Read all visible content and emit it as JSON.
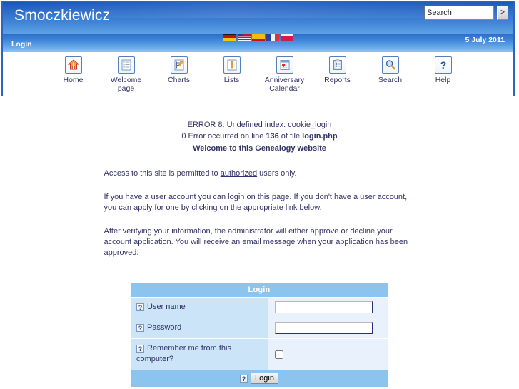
{
  "header": {
    "site_title": "Smoczkiewicz",
    "login_status": "Login",
    "date": "5 July 2011",
    "search": {
      "value": "Search",
      "placeholder": "Search",
      "go_label": ">"
    },
    "languages": [
      {
        "name": "german-flag",
        "code": "de"
      },
      {
        "name": "us-flag",
        "code": "us"
      },
      {
        "name": "spanish-flag",
        "code": "es"
      },
      {
        "name": "french-flag",
        "code": "fr"
      },
      {
        "name": "polish-flag",
        "code": "pl"
      }
    ]
  },
  "toolbar": {
    "items": [
      {
        "label": "Home",
        "icon": "home-icon"
      },
      {
        "label": "Welcome page",
        "icon": "welcome-page-icon"
      },
      {
        "label": "Charts",
        "icon": "charts-icon"
      },
      {
        "label": "Lists",
        "icon": "lists-icon"
      },
      {
        "label": "Anniversary Calendar",
        "icon": "anniversary-calendar-icon"
      },
      {
        "label": "Reports",
        "icon": "reports-icon"
      },
      {
        "label": "Search",
        "icon": "search-icon"
      },
      {
        "label": "Help",
        "icon": "help-icon"
      }
    ]
  },
  "errors": {
    "line1": "ERROR 8: Undefined index: cookie_login",
    "line2_prefix": "0 Error occurred on line ",
    "line2_number": "136",
    "line2_mid": " of file ",
    "line2_file": "login.php"
  },
  "main": {
    "welcome_heading": "Welcome to this Genealogy website",
    "para1_before": "Access to this site is permitted to ",
    "para1_link": "authorized",
    "para1_after": " users only.",
    "para2": "If you have a user account you can login on this page. If you don't have a user account, you can apply for one by clicking on the appropriate link below.",
    "para3": "After verifying your information, the administrator will either approve or decline your account application. You will receive an email message when your application has been approved."
  },
  "login_form": {
    "title": "Login",
    "username_label": "User name",
    "username_value": "",
    "password_label": "Password",
    "password_value": "",
    "remember_label": "Remember me from this computer?",
    "remember_checked": false,
    "submit_label": "Login",
    "help_glyph": "?"
  },
  "colors": {
    "title_bar_blue": "#1757B8",
    "sub_bar_blue": "#3F86D8",
    "border_blue": "#2F63BE",
    "table_header_blue": "#8CC4F0",
    "label_cell_blue": "#CCE4F8",
    "value_cell_blue": "#E9F2FC",
    "text_navy": "#333366"
  }
}
